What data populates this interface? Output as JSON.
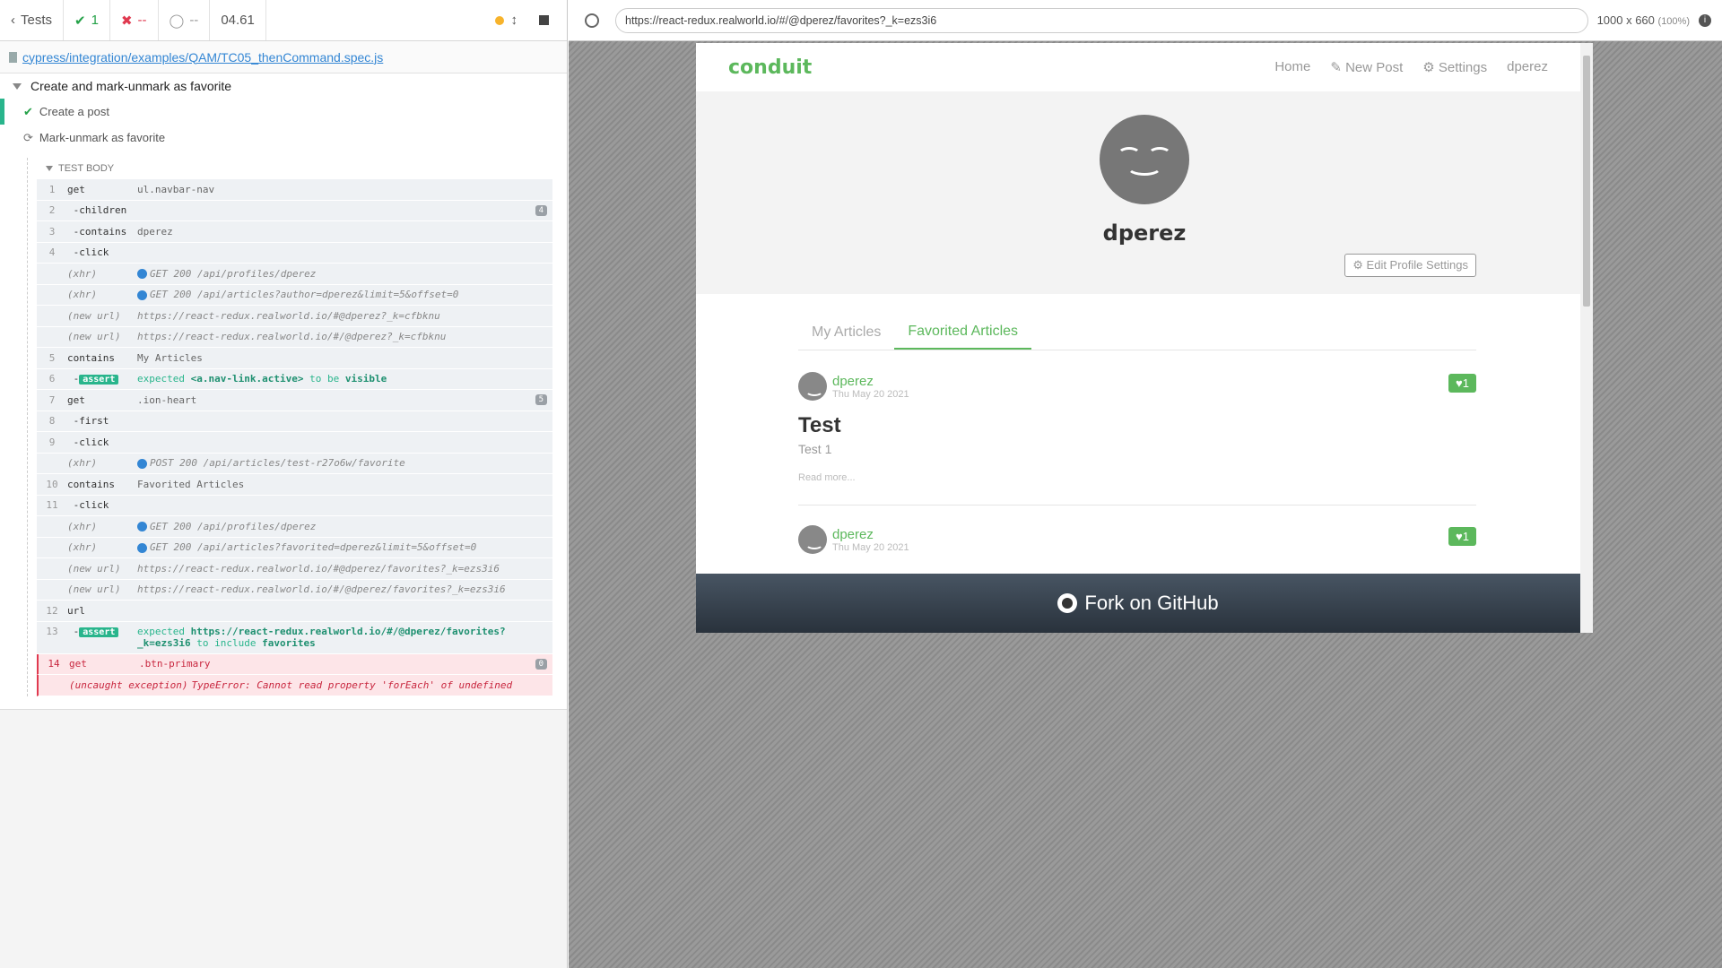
{
  "reporter": {
    "tests_label": "Tests",
    "passed_count": "1",
    "failed_count": "--",
    "pending_count": "--",
    "duration": "04.61",
    "spec_path": "cypress/integration/examples/QAM/TC05_thenCommand.spec.js",
    "suite_title": "Create and mark-unmark as favorite",
    "tests": [
      {
        "title": "Create a post",
        "state": "passed"
      },
      {
        "title": "Mark-unmark as favorite",
        "state": "running"
      }
    ],
    "test_body_label": "TEST BODY",
    "commands": [
      {
        "num": "1",
        "name": "get",
        "msg": "ul.navbar-nav"
      },
      {
        "num": "2",
        "name": " -children",
        "msg": "",
        "badge": "4"
      },
      {
        "num": "3",
        "name": " -contains",
        "msg": "dperez"
      },
      {
        "num": "4",
        "name": " -click",
        "msg": ""
      },
      {
        "num": "",
        "name": "(xhr)",
        "msg": "GET 200 /api/profiles/dperez"
      },
      {
        "num": "",
        "name": "(xhr)",
        "msg": "GET 200 /api/articles?author=dperez&limit=5&offset=0"
      },
      {
        "num": "",
        "name": "(new url)",
        "msg": "https://react-redux.realworld.io/#@dperez?_k=cfbknu"
      },
      {
        "num": "",
        "name": "(new url)",
        "msg": "https://react-redux.realworld.io/#/@dperez?_k=cfbknu"
      },
      {
        "num": "5",
        "name": "contains",
        "msg": "My Articles"
      },
      {
        "num": "6",
        "name": " -assert",
        "expected": "expected",
        "subject": "<a.nav-link.active>",
        "to": "to be",
        "value": "visible"
      },
      {
        "num": "7",
        "name": "get",
        "msg": ".ion-heart",
        "badge": "5"
      },
      {
        "num": "8",
        "name": " -first",
        "msg": ""
      },
      {
        "num": "9",
        "name": " -click",
        "msg": ""
      },
      {
        "num": "",
        "name": "(xhr)",
        "msg": "POST 200 /api/articles/test-r27o6w/favorite"
      },
      {
        "num": "10",
        "name": "contains",
        "msg": "Favorited Articles"
      },
      {
        "num": "11",
        "name": " -click",
        "msg": ""
      },
      {
        "num": "",
        "name": "(xhr)",
        "msg": "GET 200 /api/profiles/dperez"
      },
      {
        "num": "",
        "name": "(xhr)",
        "msg": "GET 200 /api/articles?favorited=dperez&limit=5&offset=0"
      },
      {
        "num": "",
        "name": "(new url)",
        "msg": "https://react-redux.realworld.io/#@dperez/favorites?_k=ezs3i6"
      },
      {
        "num": "",
        "name": "(new url)",
        "msg": "https://react-redux.realworld.io/#/@dperez/favorites?_k=ezs3i6"
      },
      {
        "num": "12",
        "name": "url",
        "msg": ""
      },
      {
        "num": "13",
        "name": " -assert",
        "expected": "expected",
        "subject": "https://react-redux.realworld.io/#/@dperez/favorites?",
        "subject2": "_k=ezs3i6",
        "to": "to include",
        "value": "favorites"
      },
      {
        "num": "14",
        "name": "get",
        "msg": ".btn-primary",
        "badge": "0"
      },
      {
        "num": "",
        "name": "(uncaught exception)",
        "msg": "TypeError: Cannot read property 'forEach' of undefined"
      }
    ],
    "assert_label": "assert"
  },
  "browser": {
    "url": "https://react-redux.realworld.io/#/@dperez/favorites?_k=ezs3i6",
    "viewport": "1000 x 660",
    "zoom": "(100%)",
    "info": "i"
  },
  "app": {
    "brand": "conduit",
    "nav": {
      "home": "Home",
      "new_post": "New Post",
      "settings": "Settings",
      "user": "dperez"
    },
    "profile_name": "dperez",
    "edit_profile": "Edit Profile Settings",
    "tabs": {
      "my_articles": "My Articles",
      "favorited": "Favorited Articles"
    },
    "articles": [
      {
        "author": "dperez",
        "date": "Thu May 20 2021",
        "likes": "1",
        "title": "Test",
        "description": "Test 1",
        "read_more": "Read more..."
      },
      {
        "author": "dperez",
        "date": "Thu May 20 2021",
        "likes": "1"
      }
    ],
    "footer": "Fork on GitHub"
  }
}
